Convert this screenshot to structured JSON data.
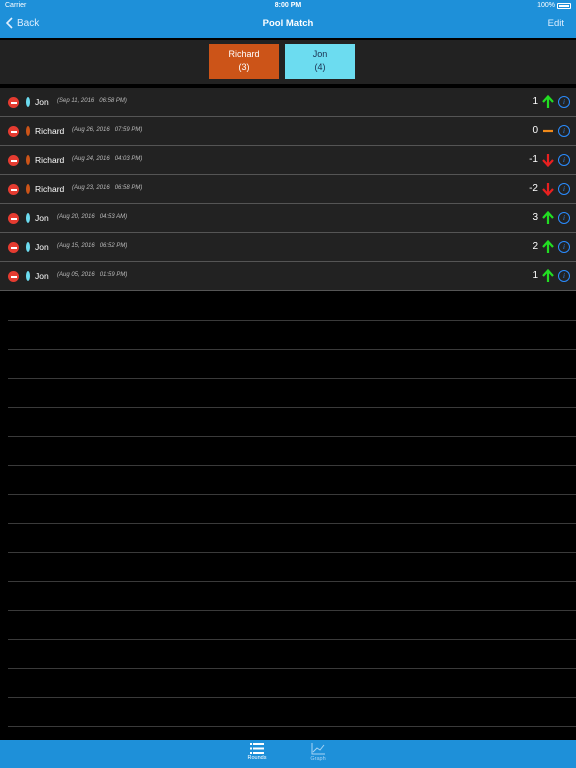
{
  "status": {
    "carrier": "Carrier",
    "time": "8:00 PM",
    "battery": "100%"
  },
  "nav": {
    "back_label": "Back",
    "title": "Pool Match",
    "edit_label": "Edit"
  },
  "players": [
    {
      "name": "Richard",
      "score": "(3)",
      "color": "#cc5418"
    },
    {
      "name": "Jon",
      "score": "(4)",
      "color": "#6cdcf0"
    }
  ],
  "rounds": [
    {
      "name": "Jon",
      "player": "jon",
      "date": "(Sep 11, 2016   06:58 PM)",
      "score": "1",
      "trend": "up"
    },
    {
      "name": "Richard",
      "player": "richard",
      "date": "(Aug 26, 2016   07:59 PM)",
      "score": "0",
      "trend": "flat"
    },
    {
      "name": "Richard",
      "player": "richard",
      "date": "(Aug 24, 2016   04:03 PM)",
      "score": "-1",
      "trend": "down"
    },
    {
      "name": "Richard",
      "player": "richard",
      "date": "(Aug 23, 2016   06:58 PM)",
      "score": "-2",
      "trend": "down"
    },
    {
      "name": "Jon",
      "player": "jon",
      "date": "(Aug 20, 2016   04:53 AM)",
      "score": "3",
      "trend": "up"
    },
    {
      "name": "Jon",
      "player": "jon",
      "date": "(Aug 15, 2016   06:52 PM)",
      "score": "2",
      "trend": "up"
    },
    {
      "name": "Jon",
      "player": "jon",
      "date": "(Aug 05, 2016   01:59 PM)",
      "score": "1",
      "trend": "up"
    }
  ],
  "tabs": {
    "rounds_label": "Rounds",
    "graph_label": "Graph"
  },
  "colors": {
    "bar": "#1e90d9",
    "up": "#22dd22",
    "down": "#e82020",
    "flat": "#f08a1a",
    "info": "#2a8cff"
  },
  "icons": {
    "back": "chevron-left-icon",
    "delete": "minus-circle-icon",
    "info": "info-icon",
    "rounds": "list-icon",
    "graph": "graph-icon"
  }
}
